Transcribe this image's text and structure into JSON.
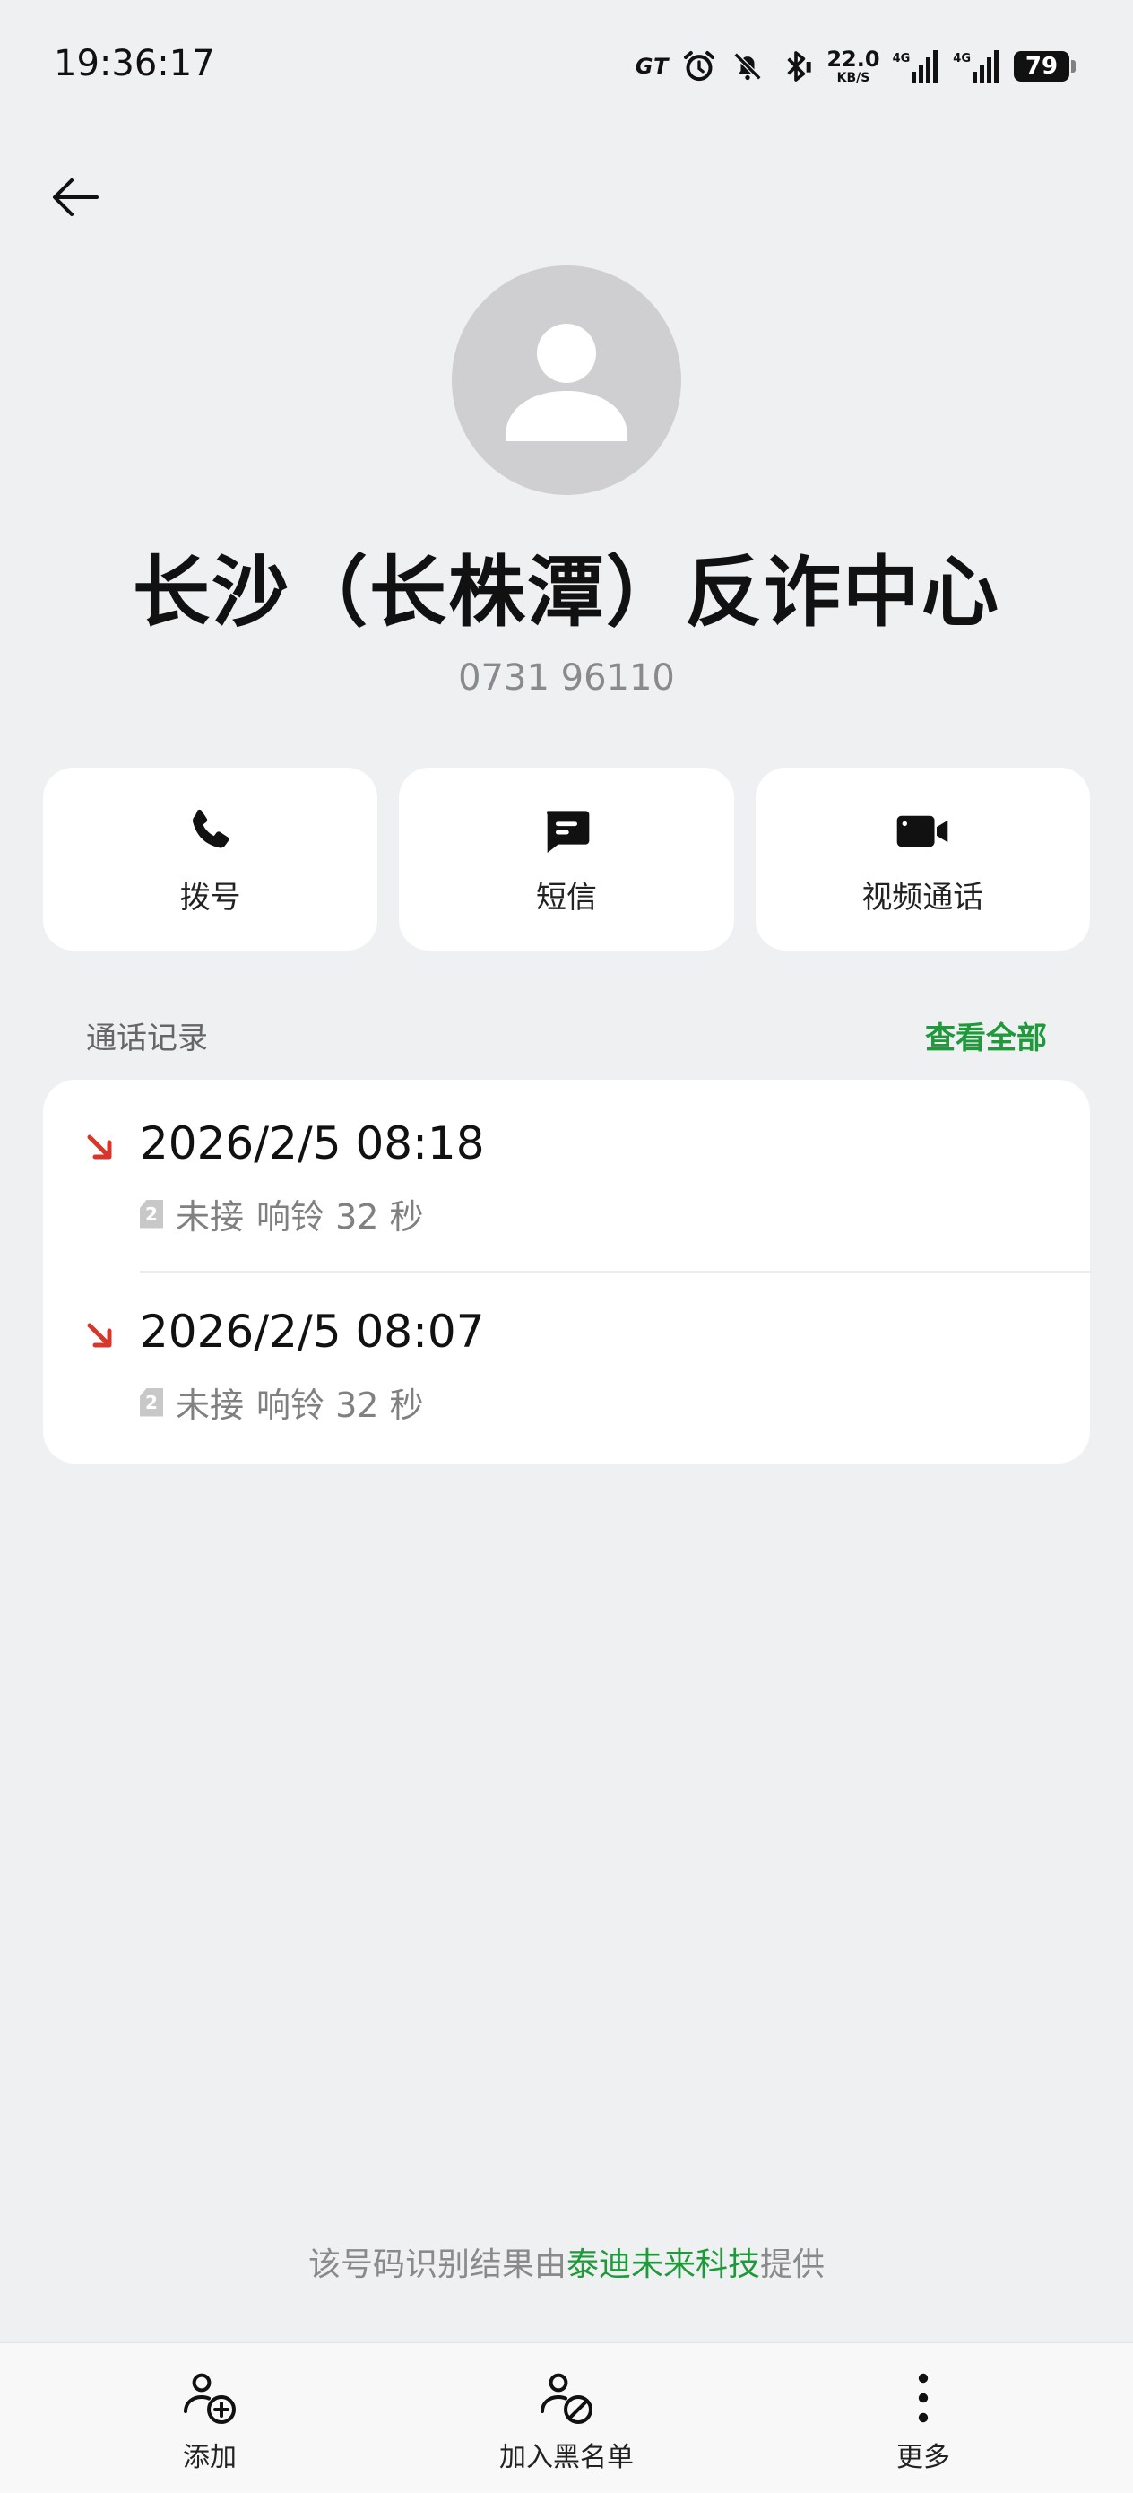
{
  "status_bar": {
    "time": "19:36:17",
    "gt_label": "GT",
    "net_speed_value": "22.0",
    "net_speed_unit": "KB/S",
    "signal1_type": "4G",
    "signal2_type": "4G",
    "battery_level": "79"
  },
  "contact": {
    "name": "长沙（长株潭）反诈中心",
    "number": "0731 96110"
  },
  "actions": [
    {
      "label": "拨号",
      "icon": "phone-icon"
    },
    {
      "label": "短信",
      "icon": "message-icon"
    },
    {
      "label": "视频通话",
      "icon": "video-camera-icon"
    }
  ],
  "call_log": {
    "title": "通话记录",
    "view_all": "查看全部",
    "entries": [
      {
        "datetime": "2026/2/5 08:18",
        "sim": "2",
        "status": "未接",
        "ring": "响铃 32 秒",
        "direction": "missed-incoming"
      },
      {
        "datetime": "2026/2/5 08:07",
        "sim": "2",
        "status": "未接",
        "ring": "响铃 32 秒",
        "direction": "missed-incoming"
      }
    ]
  },
  "attribution": {
    "prefix": "该号码识别结果由",
    "brand": "泰迪未来科技",
    "suffix": "提供"
  },
  "bottom_bar": [
    {
      "label": "添加",
      "icon": "add-contact-icon"
    },
    {
      "label": "加入黑名单",
      "icon": "block-contact-icon"
    },
    {
      "label": "更多",
      "icon": "more-vertical-icon"
    }
  ],
  "colors": {
    "background": "#eff0f2",
    "accent_green": "#1e9a3a",
    "missed_red": "#d9362b",
    "card": "#ffffff"
  }
}
